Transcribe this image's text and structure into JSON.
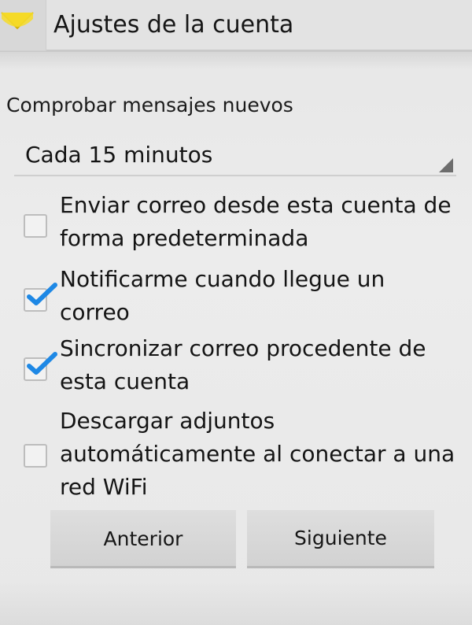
{
  "action_bar": {
    "title": "Ajustes de la cuenta",
    "app_icon": "email-app-icon"
  },
  "check_frequency": {
    "label": "Comprobar mensajes nuevos",
    "selected_value": "Cada 15 minutos",
    "arrow_icon": "spinner-triangle-icon"
  },
  "options": [
    {
      "label": "Enviar correo desde esta cuenta de forma predeterminada",
      "checked": false
    },
    {
      "label": "Notificarme cuando llegue un correo",
      "checked": true
    },
    {
      "label": "Sincronizar correo procedente de esta cuenta",
      "checked": true
    },
    {
      "label": "Descargar adjuntos automáticamente al conectar a una red WiFi",
      "checked": false
    }
  ],
  "buttons": {
    "previous_label": "Anterior",
    "next_label": "Siguiente"
  },
  "colors": {
    "accent_checkmark": "#1e88e5",
    "icon_yellow": "#f2d21a",
    "background": "#e9e9e9"
  }
}
